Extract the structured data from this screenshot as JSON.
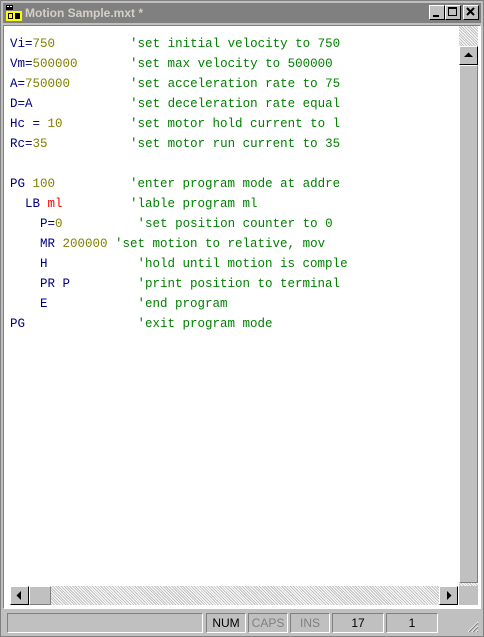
{
  "window": {
    "title": "Motion Sample.mxt *"
  },
  "editor": {
    "lines": [
      [
        {
          "t": "Vi",
          "c": "cmd"
        },
        {
          "t": "=",
          "c": "cmd"
        },
        {
          "t": "750",
          "c": "num"
        },
        {
          "t": "          'set initial velocity to 750",
          "c": "comment"
        }
      ],
      [
        {
          "t": "Vm",
          "c": "cmd"
        },
        {
          "t": "=",
          "c": "cmd"
        },
        {
          "t": "500000",
          "c": "num"
        },
        {
          "t": "       'set max velocity to 500000",
          "c": "comment"
        }
      ],
      [
        {
          "t": "A",
          "c": "cmd"
        },
        {
          "t": "=",
          "c": "cmd"
        },
        {
          "t": "750000",
          "c": "num"
        },
        {
          "t": "        'set acceleration rate to 75",
          "c": "comment"
        }
      ],
      [
        {
          "t": "D",
          "c": "cmd"
        },
        {
          "t": "=",
          "c": "cmd"
        },
        {
          "t": "A",
          "c": "cmd"
        },
        {
          "t": "             'set deceleration rate equal",
          "c": "comment"
        }
      ],
      [
        {
          "t": "Hc = ",
          "c": "cmd"
        },
        {
          "t": "10",
          "c": "num"
        },
        {
          "t": "         'set motor hold current to l",
          "c": "comment"
        }
      ],
      [
        {
          "t": "Rc",
          "c": "cmd"
        },
        {
          "t": "=",
          "c": "cmd"
        },
        {
          "t": "35",
          "c": "num"
        },
        {
          "t": "           'set motor run current to 35",
          "c": "comment"
        }
      ],
      [],
      [
        {
          "t": "PG ",
          "c": "cmd"
        },
        {
          "t": "100",
          "c": "num"
        },
        {
          "t": "          'enter program mode at addre",
          "c": "comment"
        }
      ],
      [
        {
          "t": "  LB ",
          "c": "cmd"
        },
        {
          "t": "ml",
          "c": "label"
        },
        {
          "t": "         'lable program ml",
          "c": "comment"
        }
      ],
      [
        {
          "t": "    P",
          "c": "cmd"
        },
        {
          "t": "=",
          "c": "cmd"
        },
        {
          "t": "0",
          "c": "num"
        },
        {
          "t": "          'set position counter to 0",
          "c": "comment"
        }
      ],
      [
        {
          "t": "    MR ",
          "c": "cmd"
        },
        {
          "t": "200000",
          "c": "num"
        },
        {
          "t": " 'set motion to relative, mov",
          "c": "comment"
        }
      ],
      [
        {
          "t": "    H",
          "c": "cmd"
        },
        {
          "t": "            'hold until motion is comple",
          "c": "comment"
        }
      ],
      [
        {
          "t": "    PR P",
          "c": "cmd"
        },
        {
          "t": "         'print position to terminal",
          "c": "comment"
        }
      ],
      [
        {
          "t": "    E",
          "c": "cmd"
        },
        {
          "t": "            'end program",
          "c": "comment"
        }
      ],
      [
        {
          "t": "PG",
          "c": "cmd"
        },
        {
          "t": "               'exit program mode",
          "c": "comment"
        }
      ]
    ]
  },
  "statusbar": {
    "num": "NUM",
    "caps": "CAPS",
    "ins": "INS",
    "line": "17",
    "col": "1"
  },
  "colors": {
    "command": "#000080",
    "number": "#808000",
    "label": "#ff0000",
    "comment": "#008000",
    "disabled_text": "#808080"
  },
  "icons": {
    "app": "mxt-file-icon",
    "minimize": "minimize-icon",
    "maximize": "maximize-icon",
    "close": "close-icon",
    "scroll_up": "arrow-up-icon",
    "scroll_left": "arrow-left-icon",
    "scroll_right": "arrow-right-icon",
    "resize": "resize-grip-icon"
  }
}
